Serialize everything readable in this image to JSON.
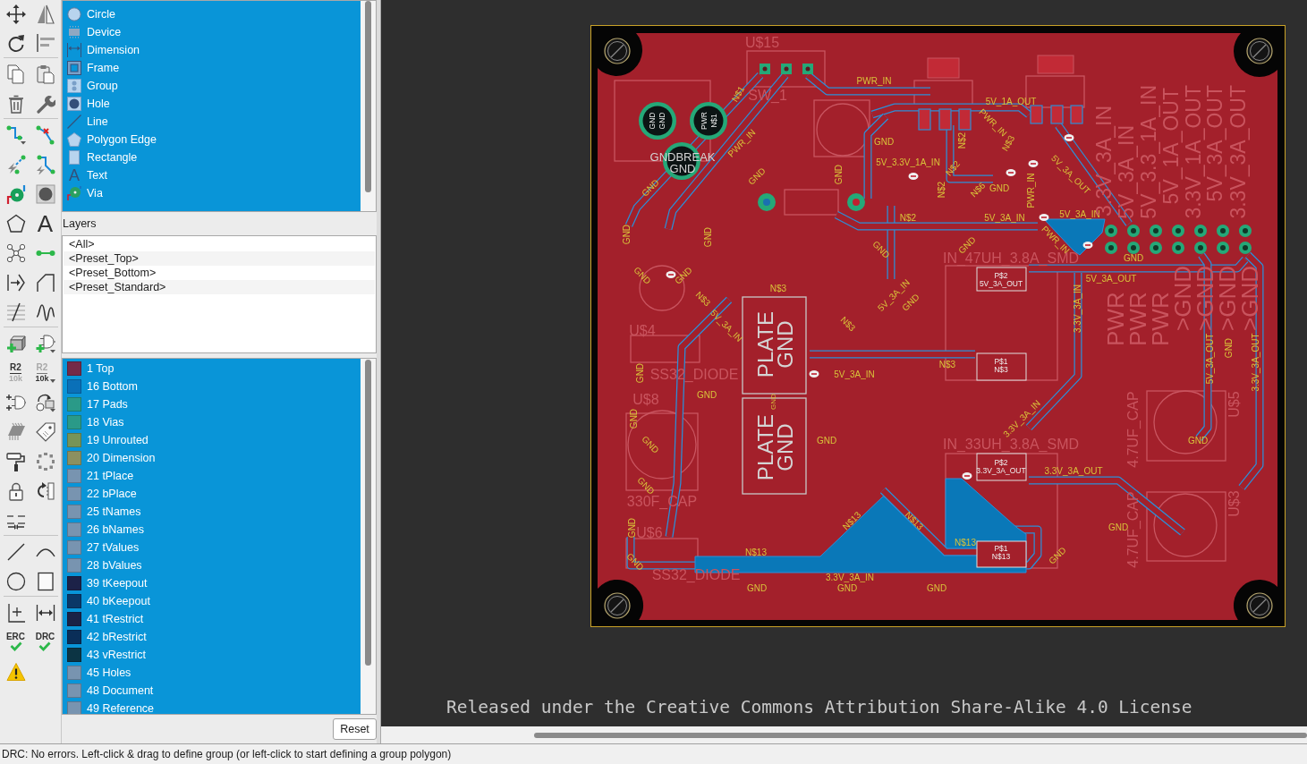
{
  "toolbar": {
    "text_tool": "A",
    "name_tool": {
      "top": "R2",
      "bottom": "10k"
    },
    "value_tool": {
      "top": "R2",
      "bottom": "10k"
    },
    "erc_tool": "ERC",
    "drc_tool": "DRC"
  },
  "object_list": {
    "items": [
      {
        "label": "Circle",
        "selected": true
      },
      {
        "label": "Device",
        "selected": true
      },
      {
        "label": "Dimension",
        "selected": true
      },
      {
        "label": "Frame",
        "selected": true
      },
      {
        "label": "Group",
        "selected": true
      },
      {
        "label": "Hole",
        "selected": true
      },
      {
        "label": "Line",
        "selected": true
      },
      {
        "label": "Polygon Edge",
        "selected": true
      },
      {
        "label": "Rectangle",
        "selected": true
      },
      {
        "label": "Text",
        "glyph": "A",
        "selected": true
      },
      {
        "label": "Via",
        "selected": true
      }
    ]
  },
  "layers": {
    "title": "Layers",
    "presets": [
      {
        "label": "<All>"
      },
      {
        "label": "<Preset_Top>"
      },
      {
        "label": "<Preset_Bottom>"
      },
      {
        "label": "<Preset_Standard>"
      }
    ],
    "items": [
      {
        "label": "1 Top",
        "color": "#742a48",
        "selected": true
      },
      {
        "label": "16 Bottom",
        "color": "#0a70b8",
        "selected": true
      },
      {
        "label": "17 Pads",
        "color": "#2a9a88",
        "selected": true
      },
      {
        "label": "18 Vias",
        "color": "#2a9a88",
        "selected": true
      },
      {
        "label": "19 Unrouted",
        "color": "#769458",
        "selected": true
      },
      {
        "label": "20 Dimension",
        "color": "#8c9060",
        "selected": true
      },
      {
        "label": "21 tPlace",
        "color": "#7894b0",
        "selected": true
      },
      {
        "label": "22 bPlace",
        "color": "#7894b0",
        "selected": true
      },
      {
        "label": "25 tNames",
        "color": "#7894b0",
        "selected": true
      },
      {
        "label": "26 bNames",
        "color": "#7894b0",
        "selected": true
      },
      {
        "label": "27 tValues",
        "color": "#7894b0",
        "selected": true
      },
      {
        "label": "28 bValues",
        "color": "#7894b0",
        "selected": true
      },
      {
        "label": "39 tKeepout",
        "color": "#1c2248",
        "selected": true
      },
      {
        "label": "40 bKeepout",
        "color": "#0a3868",
        "selected": true
      },
      {
        "label": "41 tRestrict",
        "color": "#1a2246",
        "selected": true
      },
      {
        "label": "42 bRestrict",
        "color": "#0a2e58",
        "selected": true
      },
      {
        "label": "43 vRestrict",
        "color": "#0c3444",
        "selected": true
      },
      {
        "label": "45 Holes",
        "color": "#7894b0",
        "selected": true
      },
      {
        "label": "48 Document",
        "color": "#7894b0",
        "selected": true
      },
      {
        "label": "49 Reference",
        "color": "#7894b0",
        "selected": true
      }
    ],
    "reset_button": "Reset"
  },
  "canvas": {
    "board": {
      "labels": [
        {
          "kind": "name",
          "text": "U$15"
        },
        {
          "kind": "net",
          "text": "PWR_IN"
        },
        {
          "kind": "net",
          "text": "N$1"
        },
        {
          "kind": "name",
          "text": "SW_1"
        },
        {
          "kind": "net",
          "text": "5V_1A_OUT"
        },
        {
          "kind": "pad",
          "text": "GND"
        },
        {
          "kind": "pad",
          "text": "GND"
        },
        {
          "kind": "pad",
          "text": "PWR"
        },
        {
          "kind": "pad",
          "text": "N$1"
        },
        {
          "kind": "net",
          "text": "PWR_IN"
        },
        {
          "kind": "net",
          "text": "PWR_IN"
        },
        {
          "kind": "net",
          "text": "GND"
        },
        {
          "kind": "net",
          "text": "N$2"
        },
        {
          "kind": "net",
          "text": "N$3"
        },
        {
          "kind": "silk",
          "text": "GNDBREAK"
        },
        {
          "kind": "silk",
          "text": "GND"
        },
        {
          "kind": "net",
          "text": "5V_3.3V_1A_IN"
        },
        {
          "kind": "net",
          "text": "N$2"
        },
        {
          "kind": "net",
          "text": "GND"
        },
        {
          "kind": "net",
          "text": "GND"
        },
        {
          "kind": "net",
          "text": "N$2"
        },
        {
          "kind": "net",
          "text": "N$6"
        },
        {
          "kind": "net",
          "text": "GND"
        },
        {
          "kind": "net",
          "text": "PWR_IN"
        },
        {
          "kind": "net",
          "text": "GND"
        },
        {
          "kind": "net",
          "text": "5V_3A_OUT"
        },
        {
          "kind": "net",
          "text": "N$2"
        },
        {
          "kind": "net",
          "text": "5V_3A_IN"
        },
        {
          "kind": "net",
          "text": "5V_3A_IN"
        },
        {
          "kind": "net",
          "text": "GND"
        },
        {
          "kind": "net",
          "text": "GND"
        },
        {
          "kind": "net",
          "text": "GND"
        },
        {
          "kind": "net",
          "text": "GND"
        },
        {
          "kind": "net",
          "text": "PWR_IN"
        },
        {
          "kind": "net",
          "text": "GND"
        },
        {
          "kind": "name",
          "text": "IN_47UH_3.8A_SMD"
        },
        {
          "kind": "pad",
          "text": "P$2"
        },
        {
          "kind": "pad",
          "text": "5V_3A_OUT"
        },
        {
          "kind": "net",
          "text": "5V_3A_OUT"
        },
        {
          "kind": "net",
          "text": "GND"
        },
        {
          "kind": "net",
          "text": "GND"
        },
        {
          "kind": "net",
          "text": "N$3"
        },
        {
          "kind": "net",
          "text": "5V_3A_IN"
        },
        {
          "kind": "net",
          "text": "GND"
        },
        {
          "kind": "net",
          "text": "3.3V_3A_IN"
        },
        {
          "kind": "name",
          "text": "3.3V_3A_IN"
        },
        {
          "kind": "name",
          "text": "5V_3A_IN"
        },
        {
          "kind": "name",
          "text": "5V_3.3_1A_IN"
        },
        {
          "kind": "name",
          "text": "5V_1A_OUT"
        },
        {
          "kind": "name",
          "text": "3.3V_1A_OUT"
        },
        {
          "kind": "name",
          "text": "5V_3A_OUT"
        },
        {
          "kind": "name",
          "text": "3.3V_3A_OUT"
        },
        {
          "kind": "name",
          "text": "PWR"
        },
        {
          "kind": "name",
          "text": "PWR"
        },
        {
          "kind": "name",
          "text": "PWR"
        },
        {
          "kind": "name",
          "text": ">GND"
        },
        {
          "kind": "name",
          "text": ">GND"
        },
        {
          "kind": "name",
          "text": ">GND"
        },
        {
          "kind": "name",
          "text": ">GND"
        },
        {
          "kind": "net",
          "text": "N$3"
        },
        {
          "kind": "net",
          "text": "5V_3A_IN"
        },
        {
          "kind": "name",
          "text": "U$4"
        },
        {
          "kind": "silk",
          "text": "PLATE"
        },
        {
          "kind": "silk",
          "text": "GND"
        },
        {
          "kind": "net",
          "text": "N$3"
        },
        {
          "kind": "net",
          "text": "N$3"
        },
        {
          "kind": "pad",
          "text": "P$1"
        },
        {
          "kind": "pad",
          "text": "N$3"
        },
        {
          "kind": "net",
          "text": "GND"
        },
        {
          "kind": "name",
          "text": "SS32_DIODE"
        },
        {
          "kind": "net",
          "text": "5V_3A_IN"
        },
        {
          "kind": "net",
          "text": "GND"
        },
        {
          "kind": "name",
          "text": "U$8"
        },
        {
          "kind": "net",
          "text": "GND"
        },
        {
          "kind": "net",
          "text": "GND"
        },
        {
          "kind": "silk",
          "text": "PLATE"
        },
        {
          "kind": "silk",
          "text": "GND"
        },
        {
          "kind": "net",
          "text": "GND"
        },
        {
          "kind": "net",
          "text": "GND"
        },
        {
          "kind": "net",
          "text": "3.3V_3A_IN"
        },
        {
          "kind": "name",
          "text": "IN_33UH_3.8A_SMD"
        },
        {
          "kind": "pad",
          "text": "P$2"
        },
        {
          "kind": "pad",
          "text": "3.3V_3A_OUT"
        },
        {
          "kind": "net",
          "text": "3.3V_3A_OUT"
        },
        {
          "kind": "net",
          "text": "GND"
        },
        {
          "kind": "name",
          "text": "330F_CAP"
        },
        {
          "kind": "net",
          "text": "N$13"
        },
        {
          "kind": "net",
          "text": "N$13"
        },
        {
          "kind": "net",
          "text": "GND"
        },
        {
          "kind": "name",
          "text": "U$6"
        },
        {
          "kind": "net",
          "text": "N$13"
        },
        {
          "kind": "net",
          "text": "N$13"
        },
        {
          "kind": "pad",
          "text": "P$1"
        },
        {
          "kind": "pad",
          "text": "N$13"
        },
        {
          "kind": "net",
          "text": "GND"
        },
        {
          "kind": "net",
          "text": "GND"
        },
        {
          "kind": "name",
          "text": "SS32_DIODE"
        },
        {
          "kind": "net",
          "text": "3.3V_3A_IN"
        },
        {
          "kind": "net",
          "text": "GND"
        },
        {
          "kind": "net",
          "text": "GND"
        },
        {
          "kind": "net",
          "text": "GND"
        },
        {
          "kind": "net",
          "text": "5V_3A_OUT"
        },
        {
          "kind": "net",
          "text": "GND"
        },
        {
          "kind": "net",
          "text": "3.3V_3A_OUT"
        },
        {
          "kind": "name",
          "text": "4.7UF_CAP"
        },
        {
          "kind": "name",
          "text": "U$5"
        },
        {
          "kind": "net",
          "text": "GND"
        },
        {
          "kind": "net",
          "text": "GND"
        },
        {
          "kind": "name",
          "text": "4.7UF_CAP"
        },
        {
          "kind": "name",
          "text": "U$3"
        }
      ]
    },
    "license": "Released under the Creative Commons Attribution Share-Alike 4.0 License"
  },
  "status_bar": "DRC: No errors. Left-click & drag to define group (or left-click to start defining a group polygon)"
}
